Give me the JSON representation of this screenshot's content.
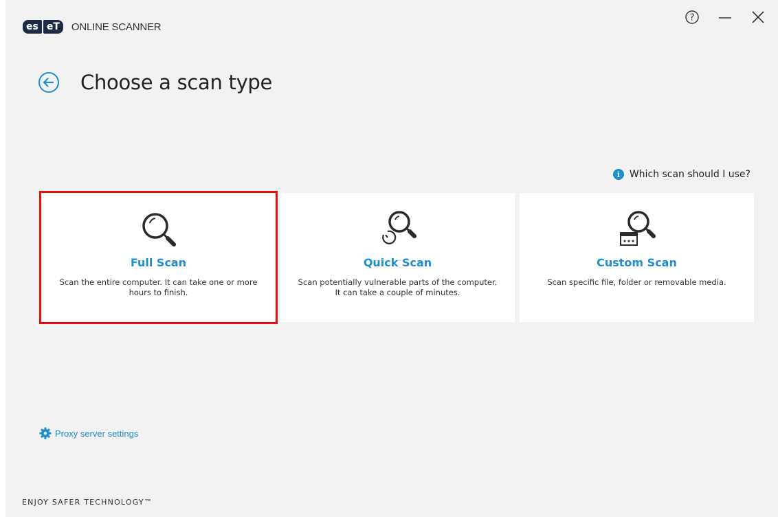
{
  "app": {
    "logo_part1": "es",
    "logo_part2": "eT",
    "name": "ONLINE SCANNER"
  },
  "window_controls": {
    "help_icon": "question-circle-icon",
    "minimize_icon": "minimize-icon",
    "close_icon": "close-icon"
  },
  "page": {
    "title": "Choose a scan type",
    "back_icon": "back-arrow-circle-icon"
  },
  "help_link": {
    "label": "Which scan should I use?",
    "icon": "info-icon"
  },
  "scan_types": [
    {
      "title": "Full Scan",
      "description": "Scan the entire computer. It can take one or more hours to finish.",
      "icon": "magnifier-icon",
      "selected": true
    },
    {
      "title": "Quick Scan",
      "description": "Scan potentially vulnerable parts of the computer. It can take a couple of minutes.",
      "icon": "magnifier-clock-icon",
      "selected": false
    },
    {
      "title": "Custom Scan",
      "description": "Scan specific file, folder or removable media.",
      "icon": "magnifier-window-icon",
      "selected": false
    }
  ],
  "proxy": {
    "label": "Proxy server settings",
    "icon": "gear-icon"
  },
  "footer": {
    "tagline": "ENJOY SAFER TECHNOLOGY™"
  },
  "colors": {
    "accent": "#1f8ecf",
    "selection_border": "#ea0f0f",
    "background": "#f2f2f2",
    "logo": "#1f2a44"
  }
}
